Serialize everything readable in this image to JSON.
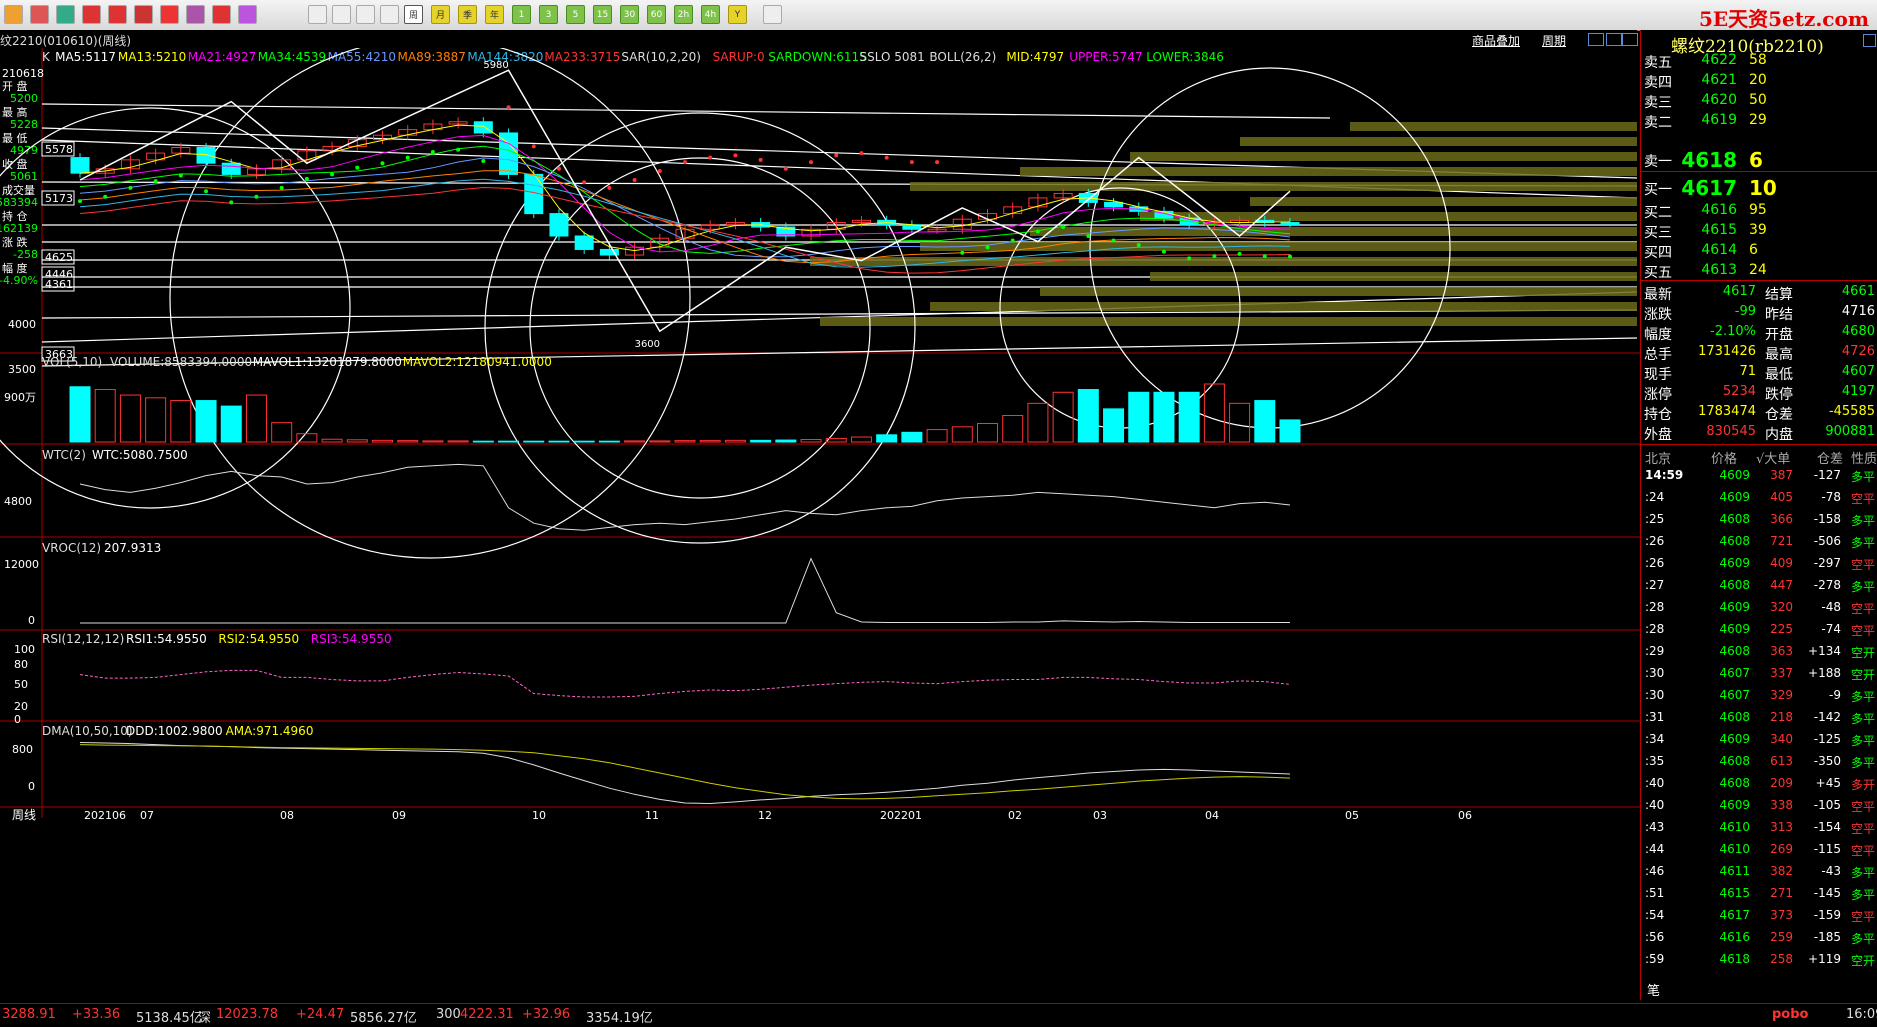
{
  "brand": "5E天资5etz.com",
  "contract_title": "螺纹2210(rb2210)",
  "window_title": "纹2210(010610)(周线)",
  "toolbar": {
    "buttons": [
      "周",
      "月",
      "季",
      "年",
      "1",
      "3",
      "5",
      "15",
      "30",
      "60",
      "2h",
      "4h",
      "Y"
    ]
  },
  "header_links": {
    "overlay": "商品叠加",
    "period": "周期"
  },
  "left_axis_info": {
    "date": "210618",
    "labels": [
      "开 盘",
      "最 高",
      "最 低",
      "收 盘",
      "成交量",
      "持 仓",
      "涨 跌",
      "幅 度"
    ],
    "values": [
      "5200",
      "5228",
      "4979",
      "5061",
      "583394",
      "162139",
      "-258",
      "-4.90%"
    ]
  },
  "main_panel": {
    "indicators": [
      {
        "text": "K",
        "color": "#dddddd"
      },
      {
        "text": "MA5:5117",
        "color": "#ffffff"
      },
      {
        "text": "MA13:5210",
        "color": "#ffff00"
      },
      {
        "text": "MA21:4927",
        "color": "#ff00ff"
      },
      {
        "text": "MA34:4539",
        "color": "#00ff00"
      },
      {
        "text": "MA55:4210",
        "color": "#6699ff"
      },
      {
        "text": "MA89:3887",
        "color": "#ff8000"
      },
      {
        "text": "MA144:3820",
        "color": "#33b5e5"
      },
      {
        "text": "MA233:3715",
        "color": "#ff3333"
      },
      {
        "text": "SAR(10,2,20)",
        "color": "#dddddd"
      },
      {
        "text": "SARUP:0",
        "color": "#ff3333"
      },
      {
        "text": "SARDOWN:6115",
        "color": "#00ff00"
      },
      {
        "text": "SSLO 5081",
        "color": "#dddddd"
      },
      {
        "text": "BOLL(26,2)",
        "color": "#dddddd"
      },
      {
        "text": "MID:4797",
        "color": "#ffff00"
      },
      {
        "text": "UPPER:5747",
        "color": "#ff00ff"
      },
      {
        "text": "LOWER:3846",
        "color": "#00ff00"
      }
    ],
    "y_ticks": [
      "5578",
      "5173",
      "4625",
      "4446",
      "4361",
      "4000",
      "3663",
      "3500"
    ],
    "marks": [
      "5980",
      "3600"
    ]
  },
  "vol_panel": {
    "label": "VOL(5,10)",
    "values": [
      {
        "text": "VOLUME:8583394.0000",
        "color": "#dddddd"
      },
      {
        "text": "MAVOL1:13201879.8000",
        "color": "#ffffff"
      },
      {
        "text": "MAVOL2:12180941.0000",
        "color": "#ffff00"
      }
    ],
    "y_tick": "900万",
    "bars": [
      20,
      19,
      17,
      16,
      15,
      15,
      13,
      17,
      7,
      3,
      1,
      0.8,
      0.6,
      0.5,
      0.4,
      0.4,
      0.3,
      0.3,
      0.3,
      0.3,
      0.3,
      0.3,
      0.4,
      0.4,
      0.5,
      0.5,
      0.6,
      0.6,
      0.7,
      0.9,
      1.3,
      1.8,
      2.6,
      3.5,
      4.5,
      5.5,
      6.7,
      9.6,
      14,
      18,
      19,
      12,
      18,
      18,
      18,
      21,
      14,
      15,
      8
    ]
  },
  "wtc_panel": {
    "label": "WTC(2)",
    "value": "WTC:5080.7500",
    "y_tick": "4800",
    "series": [
      5050,
      5010,
      4990,
      5020,
      5060,
      5110,
      5140,
      5110,
      5100,
      5050,
      5060,
      5100,
      5130,
      5170,
      5180,
      5190,
      5180,
      4880,
      4770,
      4730,
      4720,
      4740,
      4760,
      4770,
      4760,
      4780,
      4800,
      4830,
      4860,
      4840,
      4830,
      4860,
      4880,
      4890,
      4930,
      4950,
      4960,
      4970,
      4990,
      4980,
      4970,
      4960,
      4940,
      4920,
      4900,
      4880,
      4910,
      4920,
      4900
    ]
  },
  "vroc_panel": {
    "label": "VROC(12)",
    "value": "207.9313",
    "y_ticks": [
      "12000",
      "0"
    ],
    "series": [
      0,
      0,
      0,
      0,
      0,
      0,
      0,
      0,
      0,
      0,
      0,
      0,
      0,
      0,
      0,
      0,
      0,
      0,
      0,
      0,
      0,
      0,
      0,
      0,
      0,
      0,
      0,
      0,
      0,
      12500,
      2000,
      200,
      100,
      100,
      100,
      100,
      100,
      200,
      200,
      400,
      300,
      200,
      300,
      200,
      100,
      100,
      100,
      100,
      100
    ]
  },
  "rsi_panel": {
    "label": "RSI(12,12,12)",
    "values": [
      {
        "text": "RSI1:54.9550",
        "color": "#ffffff"
      },
      {
        "text": "RSI2:54.9550",
        "color": "#ffff00"
      },
      {
        "text": "RSI3:54.9550",
        "color": "#ff00ff"
      }
    ],
    "y_ticks": [
      "100",
      "80",
      "50",
      "20",
      "0"
    ],
    "series": [
      62,
      57,
      57,
      58,
      62,
      66,
      68,
      68,
      58,
      58,
      55,
      53,
      53,
      58,
      62,
      65,
      63,
      60,
      35,
      32,
      30,
      30,
      31,
      35,
      38,
      40,
      39,
      41,
      44,
      47,
      49,
      51,
      52,
      50,
      49,
      52,
      54,
      55,
      55,
      58,
      58,
      56,
      55,
      52,
      50,
      50,
      53,
      52,
      48
    ]
  },
  "dma_panel": {
    "label": "DMA(10,50,10)",
    "values": [
      {
        "text": "DDD:1002.9800",
        "color": "#ffffff"
      },
      {
        "text": "AMA:971.4960",
        "color": "#ffff00"
      }
    ],
    "y_ticks": [
      "800",
      "0"
    ],
    "ddd": [
      1000,
      990,
      980,
      960,
      940,
      930,
      920,
      900,
      890,
      880,
      870,
      860,
      850,
      840,
      830,
      820,
      790,
      700,
      560,
      400,
      250,
      100,
      -20,
      -120,
      -190,
      -200,
      -170,
      -130,
      -100,
      -60,
      -30,
      -10,
      20,
      60,
      100,
      160,
      200,
      260,
      310,
      350,
      400,
      430,
      460,
      470,
      460,
      440,
      420,
      400,
      380
    ],
    "ama": [
      960,
      950,
      945,
      940,
      935,
      930,
      920,
      910,
      900,
      895,
      890,
      885,
      880,
      875,
      870,
      860,
      850,
      830,
      800,
      740,
      680,
      600,
      500,
      400,
      300,
      200,
      110,
      40,
      -30,
      -70,
      -100,
      -110,
      -100,
      -80,
      -50,
      -20,
      10,
      50,
      80,
      120,
      160,
      200,
      240,
      270,
      300,
      320,
      330,
      320,
      300
    ]
  },
  "x_axis": {
    "period_label": "周线",
    "labels": [
      "202106",
      "07",
      "08",
      "09",
      "10",
      "11",
      "12",
      "202201",
      "02",
      "03",
      "04",
      "05",
      "06"
    ]
  },
  "order_book": {
    "asks": [
      {
        "label": "卖五",
        "price": "4622",
        "vol": "58"
      },
      {
        "label": "卖四",
        "price": "4621",
        "vol": "20"
      },
      {
        "label": "卖三",
        "price": "4620",
        "vol": "50"
      },
      {
        "label": "卖二",
        "price": "4619",
        "vol": "29"
      },
      {
        "label": "卖一",
        "price": "4618",
        "vol": "6"
      }
    ],
    "bids": [
      {
        "label": "买一",
        "price": "4617",
        "vol": "10"
      },
      {
        "label": "买二",
        "price": "4616",
        "vol": "95"
      },
      {
        "label": "买三",
        "price": "4615",
        "vol": "39"
      },
      {
        "label": "买四",
        "price": "4614",
        "vol": "6"
      },
      {
        "label": "买五",
        "price": "4613",
        "vol": "24"
      }
    ]
  },
  "quote_stats": [
    {
      "l1": "最新",
      "v1": "4617",
      "c1": "#00ff00",
      "l2": "结算",
      "v2": "4661",
      "c2": "#00ff00"
    },
    {
      "l1": "涨跌",
      "v1": "-99",
      "c1": "#00ff00",
      "l2": "昨结",
      "v2": "4716",
      "c2": "#ffffff"
    },
    {
      "l1": "幅度",
      "v1": "-2.10%",
      "c1": "#00ff00",
      "l2": "开盘",
      "v2": "4680",
      "c2": "#00ff00"
    },
    {
      "l1": "总手",
      "v1": "1731426",
      "c1": "#ffff00",
      "l2": "最高",
      "v2": "4726",
      "c2": "#ff3333"
    },
    {
      "l1": "现手",
      "v1": "71",
      "c1": "#ffff00",
      "l2": "最低",
      "v2": "4607",
      "c2": "#00ff00"
    },
    {
      "l1": "涨停",
      "v1": "5234",
      "c1": "#ff3333",
      "l2": "跌停",
      "v2": "4197",
      "c2": "#00ff00"
    },
    {
      "l1": "持仓",
      "v1": "1783474",
      "c1": "#ffff00",
      "l2": "仓差",
      "v2": "-45585",
      "c2": "#ffff00"
    },
    {
      "l1": "外盘",
      "v1": "830545",
      "c1": "#ff3333",
      "l2": "内盘",
      "v2": "900881",
      "c2": "#00ff00"
    }
  ],
  "ticks_header": [
    "北京",
    "价格",
    "√大单",
    "仓差",
    "性质"
  ],
  "ticks": [
    {
      "t": "14:59",
      "p": "4609",
      "v": "387",
      "d": "-127",
      "k": "多平",
      "kc": "#00ff00"
    },
    {
      "t": ":24",
      "p": "4609",
      "v": "405",
      "d": "-78",
      "k": "空平",
      "kc": "#ff3333"
    },
    {
      "t": ":25",
      "p": "4608",
      "v": "366",
      "d": "-158",
      "k": "多平",
      "kc": "#00ff00"
    },
    {
      "t": ":26",
      "p": "4608",
      "v": "721",
      "d": "-506",
      "k": "多平",
      "kc": "#00ff00"
    },
    {
      "t": ":26",
      "p": "4609",
      "v": "409",
      "d": "-297",
      "k": "空平",
      "kc": "#ff3333"
    },
    {
      "t": ":27",
      "p": "4608",
      "v": "447",
      "d": "-278",
      "k": "多平",
      "kc": "#00ff00"
    },
    {
      "t": ":28",
      "p": "4609",
      "v": "320",
      "d": "-48",
      "k": "空平",
      "kc": "#ff3333"
    },
    {
      "t": ":28",
      "p": "4609",
      "v": "225",
      "d": "-74",
      "k": "空平",
      "kc": "#ff3333"
    },
    {
      "t": ":29",
      "p": "4608",
      "v": "363",
      "d": "+134",
      "k": "空开",
      "kc": "#00ff00"
    },
    {
      "t": ":30",
      "p": "4607",
      "v": "337",
      "d": "+188",
      "k": "空开",
      "kc": "#00ff00"
    },
    {
      "t": ":30",
      "p": "4607",
      "v": "329",
      "d": "-9",
      "k": "多平",
      "kc": "#00ff00"
    },
    {
      "t": ":31",
      "p": "4608",
      "v": "218",
      "d": "-142",
      "k": "多平",
      "kc": "#00ff00"
    },
    {
      "t": ":34",
      "p": "4609",
      "v": "340",
      "d": "-125",
      "k": "多平",
      "kc": "#00ff00"
    },
    {
      "t": ":35",
      "p": "4608",
      "v": "613",
      "d": "-350",
      "k": "多平",
      "kc": "#00ff00"
    },
    {
      "t": ":40",
      "p": "4608",
      "v": "209",
      "d": "+45",
      "k": "多开",
      "kc": "#ff3333"
    },
    {
      "t": ":40",
      "p": "4609",
      "v": "338",
      "d": "-105",
      "k": "空平",
      "kc": "#ff3333"
    },
    {
      "t": ":43",
      "p": "4610",
      "v": "313",
      "d": "-154",
      "k": "空平",
      "kc": "#ff3333"
    },
    {
      "t": ":44",
      "p": "4610",
      "v": "269",
      "d": "-115",
      "k": "空平",
      "kc": "#ff3333"
    },
    {
      "t": ":46",
      "p": "4611",
      "v": "382",
      "d": "-43",
      "k": "多平",
      "kc": "#00ff00"
    },
    {
      "t": ":51",
      "p": "4615",
      "v": "271",
      "d": "-145",
      "k": "多平",
      "kc": "#00ff00"
    },
    {
      "t": ":54",
      "p": "4617",
      "v": "373",
      "d": "-159",
      "k": "空平",
      "kc": "#ff3333"
    },
    {
      "t": ":56",
      "p": "4616",
      "v": "259",
      "d": "-185",
      "k": "多平",
      "kc": "#00ff00"
    },
    {
      "t": ":59",
      "p": "4618",
      "v": "258",
      "d": "+119",
      "k": "空开",
      "kc": "#00ff00"
    }
  ],
  "side_tab": "笔",
  "status_bar": [
    {
      "text": "3288.91",
      "color": "#ff3333"
    },
    {
      "text": "+33.36",
      "color": "#ff3333"
    },
    {
      "text": "5138.45亿",
      "color": "#dddddd"
    },
    {
      "text": "深",
      "color": "#dddddd"
    },
    {
      "text": "12023.78",
      "color": "#ff3333"
    },
    {
      "text": "+24.47",
      "color": "#ff3333"
    },
    {
      "text": "5856.27亿",
      "color": "#dddddd"
    },
    {
      "text": "300",
      "color": "#dddddd"
    },
    {
      "text": "4222.31",
      "color": "#ff3333"
    },
    {
      "text": "+32.96",
      "color": "#ff3333"
    },
    {
      "text": "3354.19亿",
      "color": "#dddddd"
    },
    {
      "text": "pobo",
      "color": "#ff3333"
    },
    {
      "text": "16:09",
      "color": "#dddddd"
    }
  ]
}
